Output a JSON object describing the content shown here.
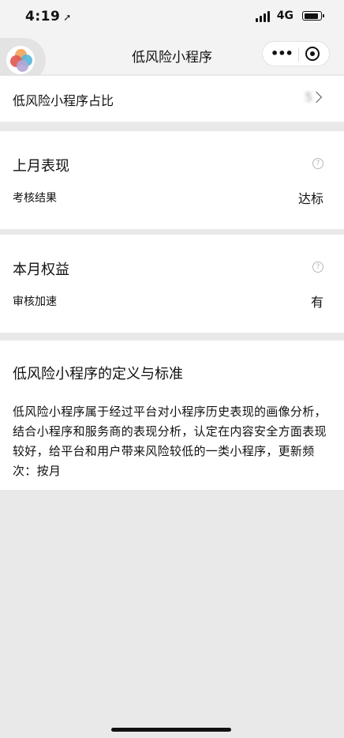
{
  "status_bar": {
    "time": "4:19",
    "network": "4G"
  },
  "nav": {
    "title": "低风险小程序",
    "more_icon": "•••"
  },
  "ratio_row": {
    "label": "低风险小程序占比",
    "value": "5"
  },
  "last_month": {
    "title": "上月表现",
    "help_icon": "?",
    "metric_label": "考核结果",
    "metric_value": "达标"
  },
  "this_month": {
    "title": "本月权益",
    "help_icon": "?",
    "metric_label": "审核加速",
    "metric_value": "有"
  },
  "definition": {
    "title": "低风险小程序的定义与标准",
    "body": "低风险小程序属于经过平台对小程序历史表现的画像分析，结合小程序和服务商的表现分析，认定在内容安全方面表现较好，给平台和用户带来风险较低的一类小程序，更新频次：按月"
  }
}
